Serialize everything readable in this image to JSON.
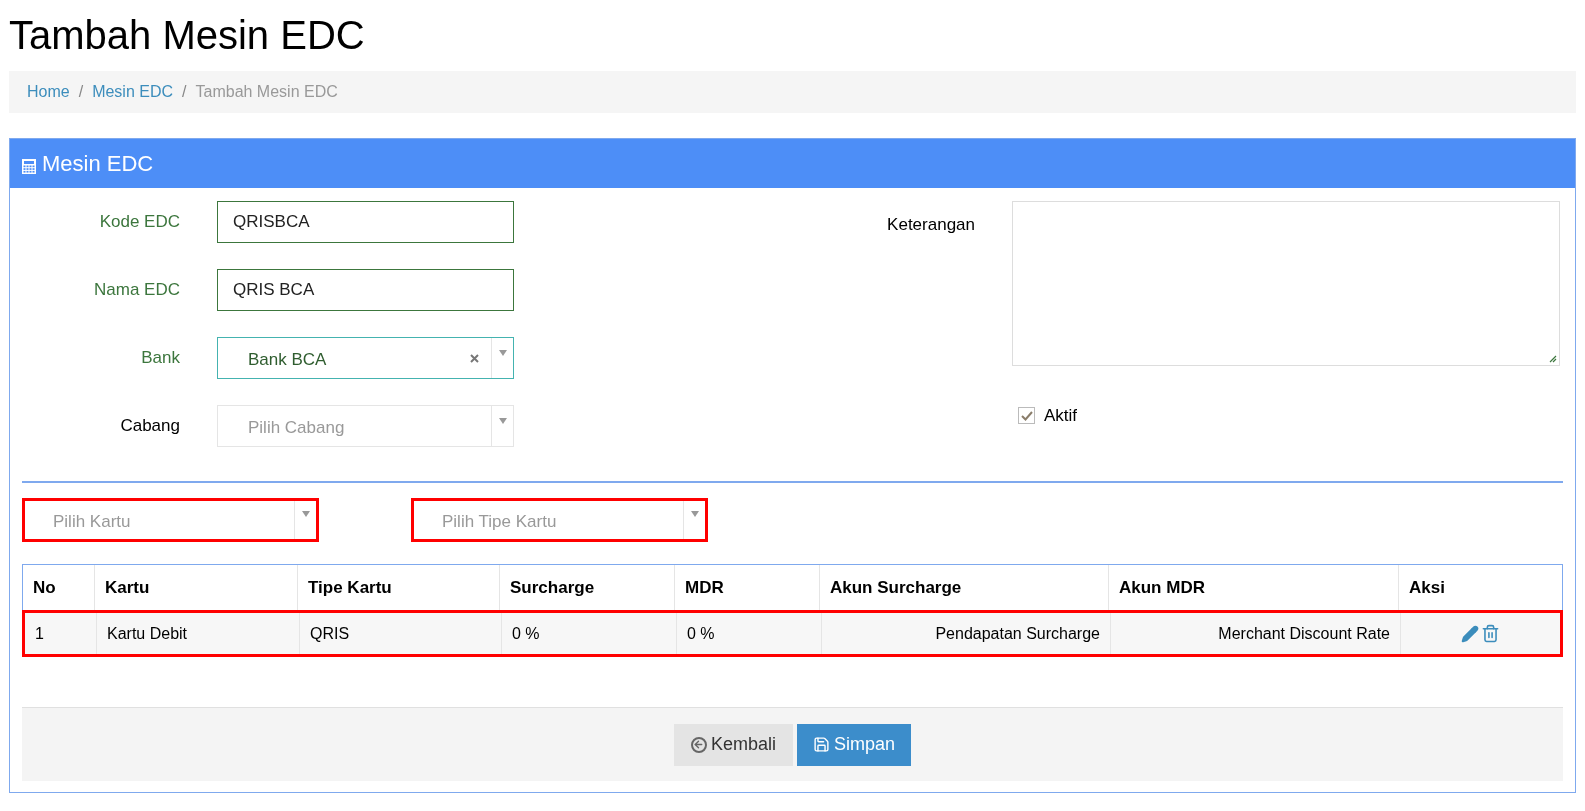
{
  "page_title": "Tambah Mesin EDC",
  "breadcrumb": [
    {
      "label": "Home",
      "link": true
    },
    {
      "separator": "/",
      "label": "Mesin EDC",
      "link": true
    },
    {
      "separator": "/",
      "label": "Tambah Mesin EDC",
      "link": false
    }
  ],
  "panel": {
    "title": "Mesin EDC"
  },
  "form_left": [
    {
      "kind": "input",
      "label": "Kode EDC",
      "value": "QRISBCA",
      "valid": true
    },
    {
      "kind": "input",
      "label": "Nama EDC",
      "value": "QRIS BCA",
      "valid": true
    },
    {
      "kind": "select",
      "label": "Bank",
      "value": "Bank BCA",
      "valid": true,
      "clearable": true
    },
    {
      "kind": "select",
      "label": "Cabang",
      "placeholder": "Pilih Cabang",
      "valid": false,
      "clearable": false
    }
  ],
  "keterangan": {
    "label": "Keterangan"
  },
  "aktif": {
    "label": "Aktif",
    "checked": true
  },
  "filters": [
    {
      "placeholder": "Pilih Kartu",
      "highlighted": true
    },
    {
      "placeholder": "Pilih Tipe Kartu",
      "highlighted": true
    }
  ],
  "table": {
    "columns": [
      "No",
      "Kartu",
      "Tipe Kartu",
      "Surcharge",
      "MDR",
      "Akun Surcharge",
      "Akun MDR",
      "Aksi"
    ],
    "rows": [
      {
        "cells": [
          "1",
          "Kartu Debit",
          "QRIS",
          "0 %",
          "0 %",
          "Pendapatan Surcharge",
          "Merchant Discount Rate"
        ],
        "highlighted": true
      }
    ]
  },
  "buttons": [
    {
      "kind": "back",
      "label": "Kembali"
    },
    {
      "kind": "save",
      "label": "Simpan"
    }
  ]
}
